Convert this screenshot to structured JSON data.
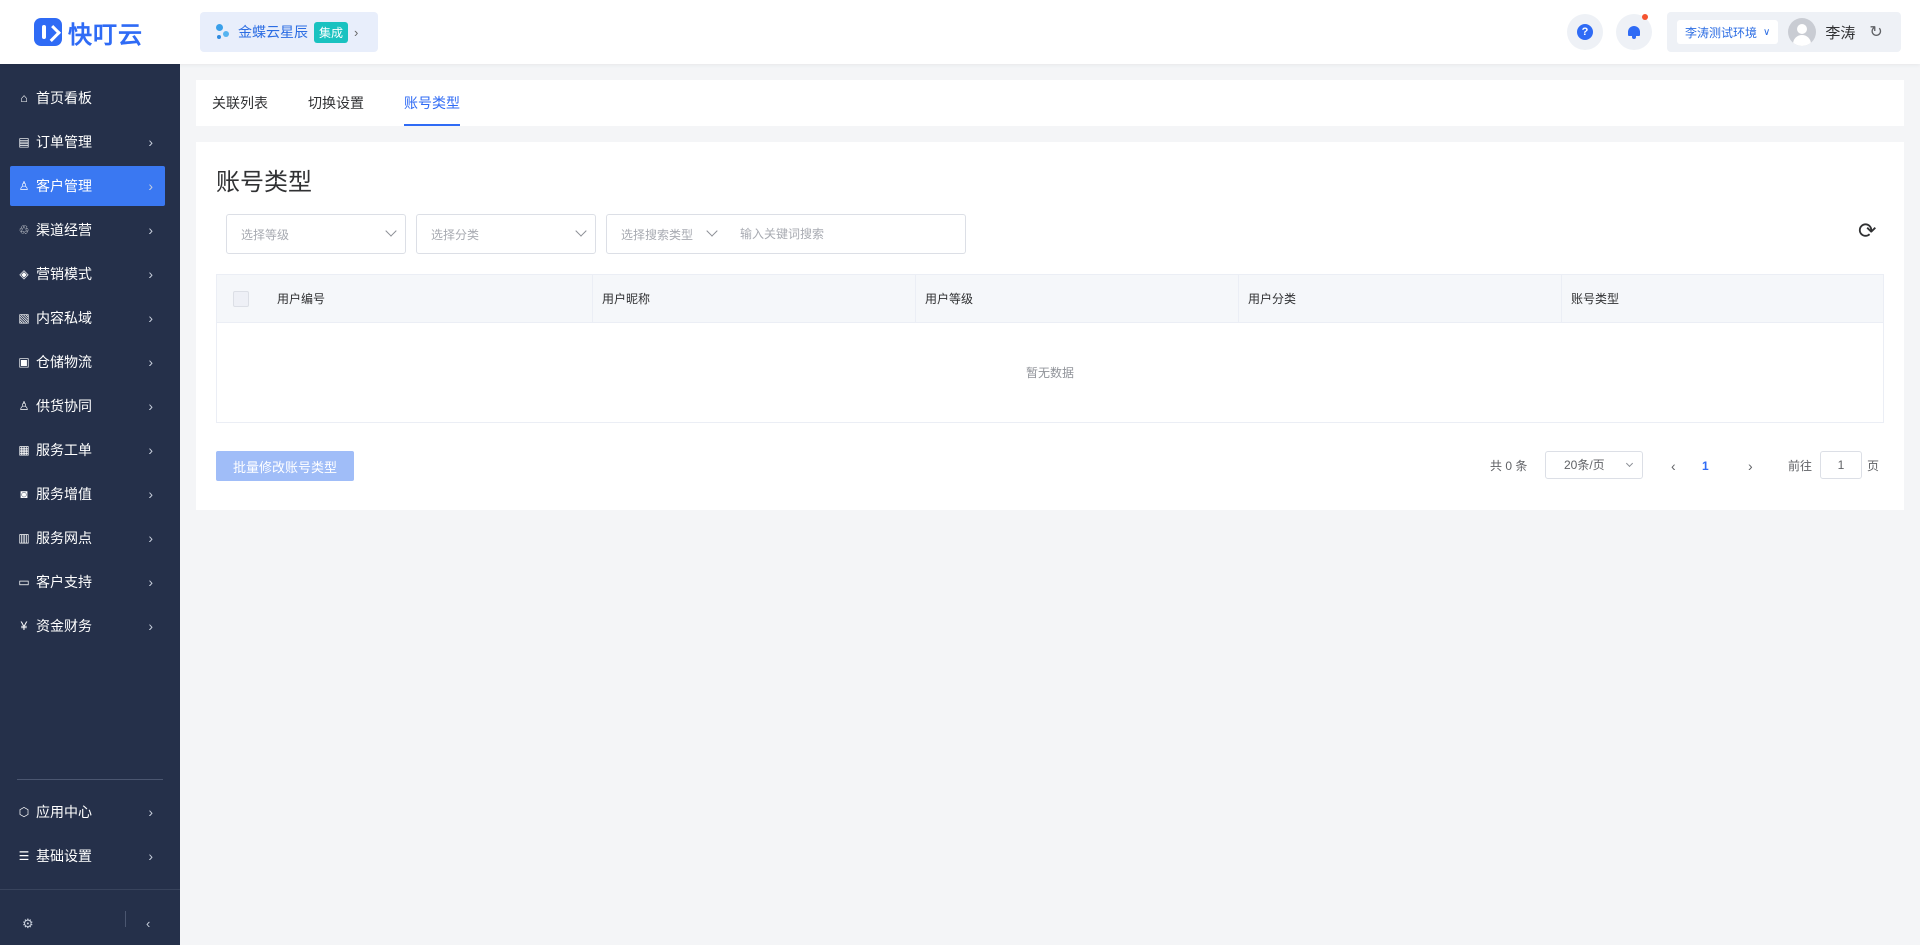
{
  "header": {
    "logo_text": "快叮云",
    "app_name": "金蝶云星辰",
    "app_badge": "集成",
    "env_name": "李涛测试环境",
    "user_name": "李涛"
  },
  "sidebar": {
    "items": [
      {
        "label": "首页看板",
        "icon": "home-icon"
      },
      {
        "label": "订单管理",
        "icon": "clipboard-icon"
      },
      {
        "label": "客户管理",
        "icon": "user-icon",
        "active": true
      },
      {
        "label": "渠道经营",
        "icon": "channel-icon"
      },
      {
        "label": "营销模式",
        "icon": "tag-icon"
      },
      {
        "label": "内容私域",
        "icon": "image-icon"
      },
      {
        "label": "仓储物流",
        "icon": "box-icon"
      },
      {
        "label": "供货协同",
        "icon": "supply-icon"
      },
      {
        "label": "服务工单",
        "icon": "ticket-icon"
      },
      {
        "label": "服务增值",
        "icon": "bag-icon"
      },
      {
        "label": "服务网点",
        "icon": "store-icon"
      },
      {
        "label": "客户支持",
        "icon": "support-icon"
      },
      {
        "label": "资金财务",
        "icon": "yen-icon"
      }
    ],
    "bottom_items": [
      {
        "label": "应用中心",
        "icon": "cube-icon"
      },
      {
        "label": "基础设置",
        "icon": "sliders-icon"
      }
    ]
  },
  "tabs": [
    {
      "label": "关联列表"
    },
    {
      "label": "切换设置"
    },
    {
      "label": "账号类型",
      "active": true
    }
  ],
  "page": {
    "title": "账号类型",
    "filters": {
      "level_placeholder": "选择等级",
      "category_placeholder": "选择分类",
      "search_type_placeholder": "选择搜索类型",
      "keyword_placeholder": "输入关键词搜索"
    },
    "table": {
      "columns": [
        "用户编号",
        "用户昵称",
        "用户等级",
        "用户分类",
        "账号类型"
      ],
      "rows": [],
      "empty_text": "暂无数据"
    },
    "batch_button": "批量修改账号类型",
    "pagination": {
      "total_text": "共 0 条",
      "page_size": "20条/页",
      "current_page": "1",
      "goto_prefix": "前往",
      "goto_value": "1",
      "goto_suffix": "页"
    }
  },
  "colors": {
    "primary": "#2f6bf5",
    "sidebar_bg": "#25304a",
    "active_item": "#3a78f2",
    "badge": "#19c2c0"
  }
}
